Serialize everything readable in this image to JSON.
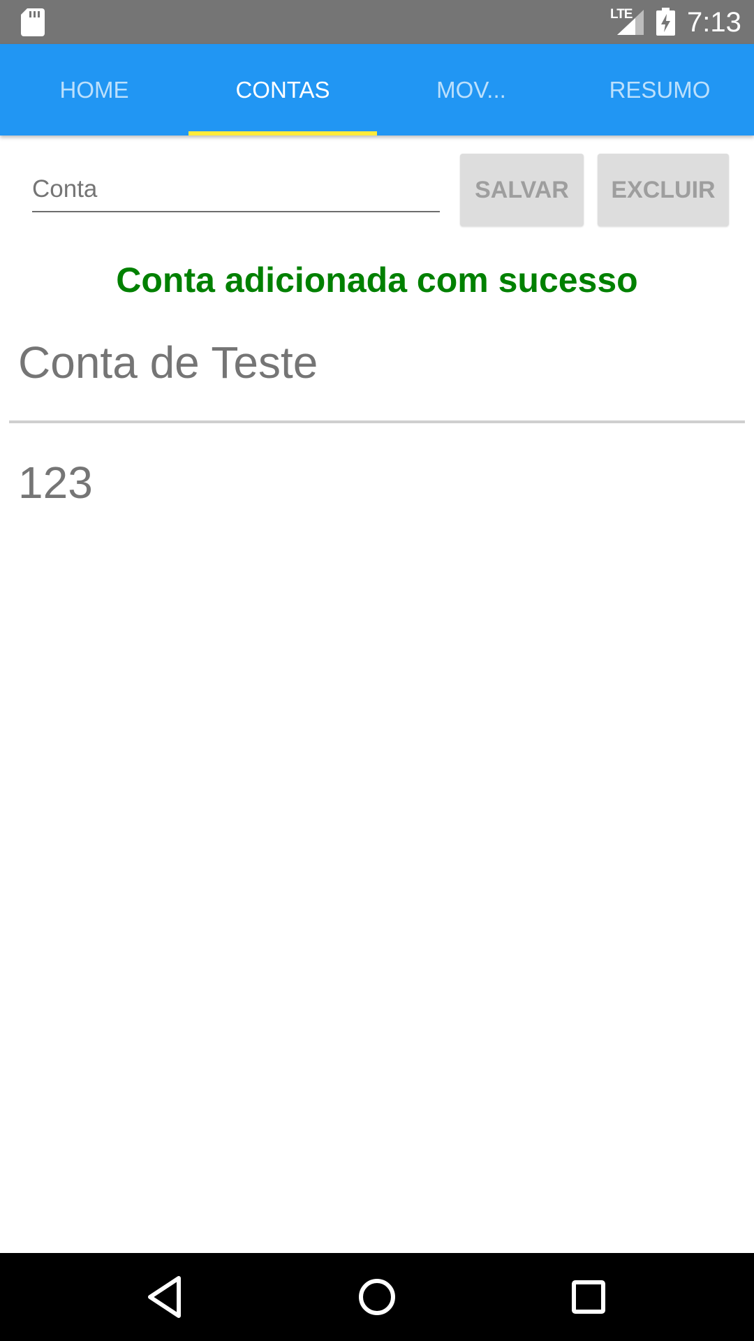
{
  "status_bar": {
    "time": "7:13",
    "network_label": "LTE",
    "icons": [
      "sd-card-icon",
      "lte-signal-icon",
      "battery-charging-icon"
    ]
  },
  "tabs": [
    {
      "label": "HOME",
      "active": false
    },
    {
      "label": "CONTAS",
      "active": true
    },
    {
      "label": "MOV...",
      "active": false
    },
    {
      "label": "RESUMO",
      "active": false
    }
  ],
  "form": {
    "account_placeholder": "Conta",
    "account_value": "",
    "save_label": "SALVAR",
    "delete_label": "EXCLUIR"
  },
  "message": {
    "text": "Conta adicionada com sucesso",
    "color": "#008000"
  },
  "accounts": [
    {
      "name": "Conta de Teste"
    },
    {
      "name": "123"
    }
  ],
  "nav_bar": {
    "icons": [
      "back-icon",
      "home-icon",
      "recents-icon"
    ]
  },
  "colors": {
    "status_bar": "#757575",
    "tab_bar": "#2196F3",
    "tab_indicator": "#FFEB3B",
    "button_bg": "#DDDDDD",
    "button_text": "#9E9E9E",
    "list_text": "#757575"
  }
}
